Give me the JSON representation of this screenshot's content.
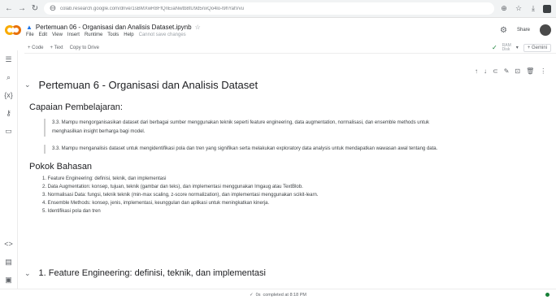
{
  "browser": {
    "url": "colab.research.google.com/drive/1sBMXwR8FfQnEiaNwtb8tU9d5nxQo4lo-l9hYatVvu",
    "back": "←",
    "forward": "→",
    "reload": "↻",
    "site_info": "⊖",
    "icons": {
      "share": "⊕",
      "bookmark": "☆",
      "download": "⤓"
    }
  },
  "colab": {
    "file_title": "Pertemuan 06 - Organisasi dan Analisis Dataset.ipynb",
    "drive_icon": "▲",
    "star": "☆",
    "menus": [
      "File",
      "Edit",
      "View",
      "Insert",
      "Runtime",
      "Tools",
      "Help"
    ],
    "save_status": "Cannot save changes",
    "settings": "⚙",
    "share_label": "Share"
  },
  "toolbar": {
    "code": "+ Code",
    "text": "+ Text",
    "copy": "Copy to Drive",
    "ram": "RAM",
    "disk": "Disk",
    "check": "✓",
    "dropdown": "▾",
    "connect": "+ Gemini"
  },
  "leftbar": [
    "☰",
    "⌕",
    "{x}",
    "⚷",
    "▭"
  ],
  "leftbar_bottom": [
    "<>",
    "▤",
    "▣"
  ],
  "cell_tools": [
    "↑",
    "↓",
    "⊂",
    "✎",
    "⊡",
    "🗑",
    "⋮"
  ],
  "notebook": {
    "title": "Pertemuan 6 - Organisasi dan Analisis Dataset",
    "capaian_heading": "Capaian Pembelajaran:",
    "capaian": [
      "3.3. Mampu mengorganisasikan dataset dari berbagai sumber menggunakan teknik seperti feature engineering, data augmentation, normalisasi, dan ensemble methods untuk menghasilkan insight berharga bagi model.",
      "3.3. Mampu menganalisis dataset untuk mengidentifikasi pola dan tren yang signifikan serta melakukan exploratory data analysis untuk mendapatkan wawasan awal tentang data."
    ],
    "pokok_heading": "Pokok Bahasan",
    "pokok": [
      "1. Feature Engineering: definisi, teknik, dan implementasi",
      "2. Data Augmentation: konsep, tujuan, teknik (gambar dan teks), dan implementasi menggunakan Imgaug atau TextBlob.",
      "3. Normalisasi Data: fungsi, teknik teknik (min-max scaling, z-score normalization), dan implementasi menggunakan scikit-learn.",
      "4. Ensemble Methods: konsep, jenis, implementasi, keunggulan dan aplikasi untuk meningkatkan kinerja.",
      "5. Identifikasi pola dan tren"
    ],
    "next_section": "1. Feature Engineering: definisi, teknik, dan implementasi"
  },
  "status": {
    "check": "✓",
    "time": "0s",
    "completed": "completed at 8:18 PM"
  }
}
